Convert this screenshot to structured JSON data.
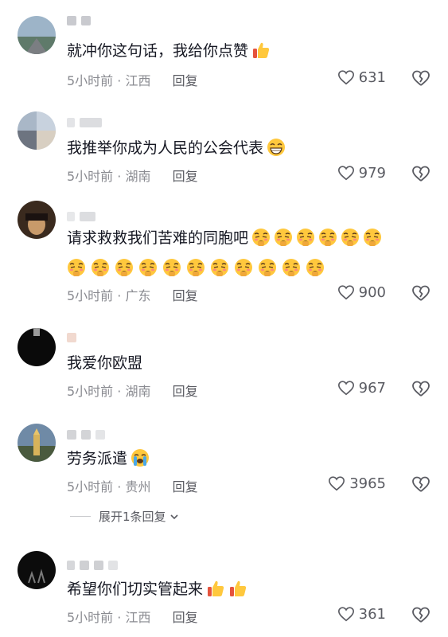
{
  "comments": [
    {
      "text": "就冲你这句话，我给你点赞",
      "emoji": "thumbs-up",
      "time": "5小时前",
      "location": "江西",
      "reply_label": "回复",
      "likes": "631"
    },
    {
      "text": "我推举你成为人民的公会代表",
      "emoji": "grin",
      "time": "5小时前",
      "location": "湖南",
      "reply_label": "回复",
      "likes": "979"
    },
    {
      "text": "请求救救我们苦难的同胞吧",
      "emoji": "pleading",
      "emoji_count": 17,
      "time": "5小时前",
      "location": "广东",
      "reply_label": "回复",
      "likes": "900"
    },
    {
      "text": "我爱你欧盟",
      "time": "5小时前",
      "location": "湖南",
      "reply_label": "回复",
      "likes": "967"
    },
    {
      "text": "劳务派遣",
      "emoji": "crying",
      "time": "5小时前",
      "location": "贵州",
      "reply_label": "回复",
      "likes": "3965",
      "expand_label": "展开1条回复"
    },
    {
      "text": "希望你们切实管起来",
      "emoji": "thumbs-up",
      "emoji_count": 2,
      "time": "5小时前",
      "location": "江西",
      "reply_label": "回复",
      "likes": "361"
    }
  ],
  "meta_separator": "·",
  "icons": {
    "like": "heart-outline-icon",
    "dislike": "broken-heart-icon",
    "expand": "chevron-down-icon"
  },
  "colors": {
    "text": "#161823",
    "meta": "#8a8b91",
    "icon": "#5a5b62",
    "emoji": "#ffc83d"
  }
}
